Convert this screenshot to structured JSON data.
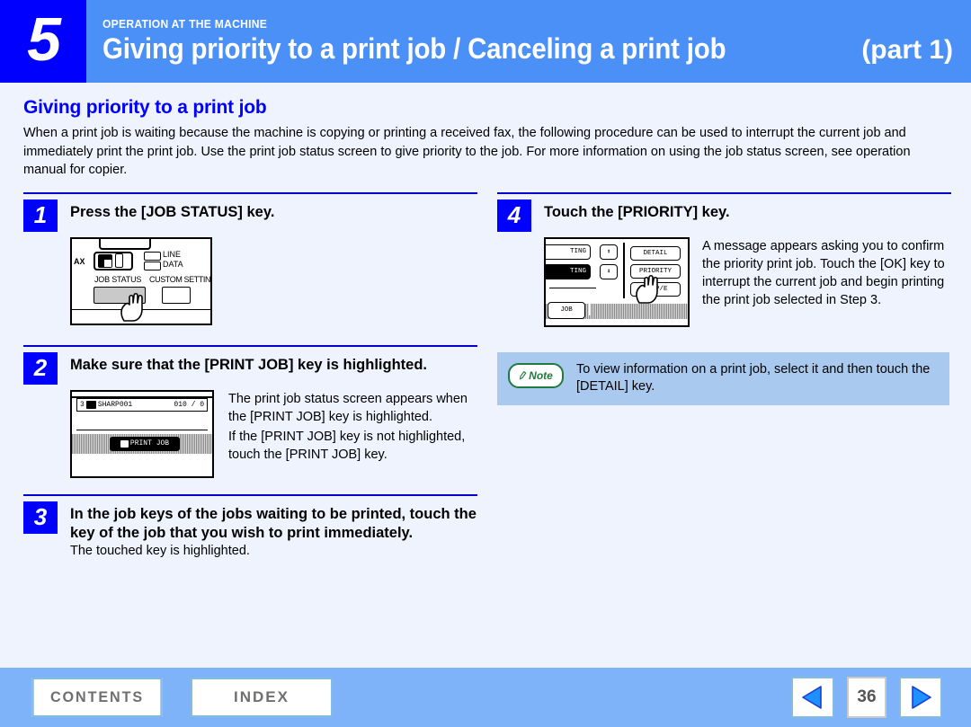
{
  "header": {
    "chapter_number": "5",
    "kicker": "OPERATION AT THE MACHINE",
    "title": "Giving priority to a print job / Canceling a print job",
    "part": "(part 1)",
    "band_color": "#4a90f7",
    "chapter_block_color": "#0000ff"
  },
  "page": {
    "background": "#eef3fd",
    "section_title": "Giving priority to a print job",
    "section_title_color": "#0000ff",
    "intro": "When a print job is waiting because the machine is copying or printing a received fax, the following procedure can be used to interrupt the current job and immediately print the print job. Use the print job status screen to give priority to the job. For more information on using the job status screen, see operation manual for copier."
  },
  "steps": [
    {
      "number": "1",
      "title": "Press the [JOB STATUS] key.",
      "illustration": {
        "type": "operation-panel",
        "fax_label": "AX",
        "lamp_line": "LINE",
        "lamp_data": "DATA",
        "job_status_label": "JOB STATUS",
        "custom_setting_label": "CUSTOM SETTING"
      }
    },
    {
      "number": "2",
      "title": "Make sure that the [PRINT JOB] key is highlighted.",
      "illustration": {
        "type": "lcd-job-status",
        "row_index": "3",
        "row_name": "SHARP001",
        "row_count": "010 / 0",
        "tab_key": "PRINT JOB"
      },
      "body": [
        "The print job status screen appears when the [PRINT JOB] key is highlighted.",
        "If the [PRINT JOB] key is not highlighted, touch the [PRINT JOB] key."
      ]
    },
    {
      "number": "3",
      "title": "In the job keys of the jobs waiting to be printed, touch the key of the job that you wish to print immediately.",
      "body": [
        "The touched key is highlighted."
      ]
    },
    {
      "number": "4",
      "title": "Touch the [PRIORITY] key.",
      "illustration": {
        "type": "lcd-priority",
        "job_a": "TING",
        "job_b": "TING",
        "key_detail": "DETAIL",
        "key_priority": "PRIORITY",
        "key_stop": "STOP/E",
        "tab_job": "JOB"
      },
      "body": [
        "A message appears asking you to confirm the priority print job. Touch the [OK] key to interrupt the current job and begin printing the print job selected in Step 3."
      ]
    }
  ],
  "note": {
    "badge_label": "Note",
    "badge_color": "#1f7a3d",
    "background": "#a9c9ef",
    "text": "To view information on a print job, select it and then touch the [DETAIL] key."
  },
  "footer": {
    "background": "#7fb3f9",
    "contents_label": "CONTENTS",
    "index_label": "INDEX",
    "page_number": "36",
    "prev_icon": "triangle-left-icon",
    "next_icon": "triangle-right-icon"
  }
}
